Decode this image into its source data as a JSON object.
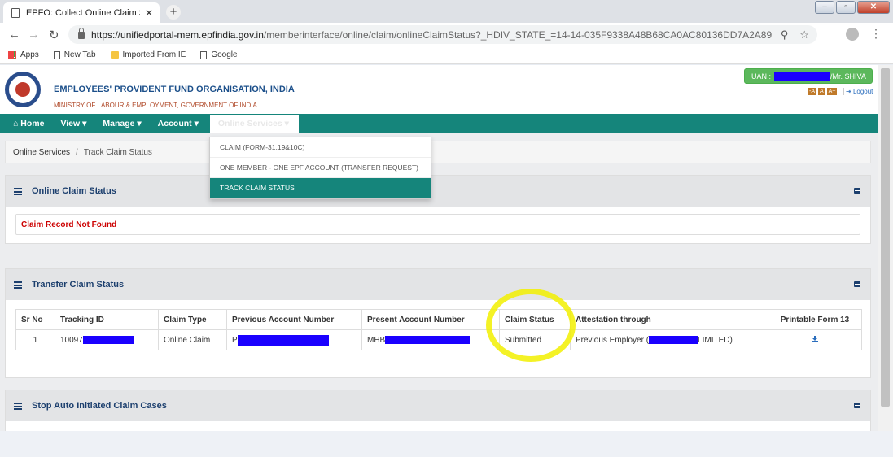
{
  "browser": {
    "tab_title": "EPFO: Collect Online Claim Status",
    "tab_close": "✕",
    "new_tab": "+",
    "url_host": "https://unifiedportal-mem.epfindia.gov.in",
    "url_path": "/memberinterface/online/claim/onlineClaimStatus?_HDIV_STATE_=14-14-035F9338A48B68CA0AC80136DD7A2A89",
    "bookmarks": [
      "Apps",
      "New Tab",
      "Imported From IE",
      "Google"
    ]
  },
  "header": {
    "org_name": "EMPLOYEES' PROVIDENT FUND ORGANISATION, INDIA",
    "ministry": "MINISTRY OF LABOUR & EMPLOYMENT, GOVERNMENT OF INDIA",
    "uan_label": "UAN :",
    "user_name": "/Mr. SHIVA",
    "font_small": "-A",
    "font_normal": "A",
    "font_large": "A+",
    "logout": "Logout"
  },
  "nav": {
    "home": "Home",
    "view": "View ▾",
    "manage": "Manage ▾",
    "account": "Account ▾",
    "online_services": "Online Services ▾"
  },
  "dropdown": {
    "items": [
      "CLAIM (FORM-31,19&10C)",
      "ONE MEMBER - ONE EPF ACCOUNT (TRANSFER REQUEST)",
      "TRACK CLAIM STATUS"
    ]
  },
  "breadcrumb": {
    "parent": "Online Services",
    "separator": "/",
    "current": "Track Claim Status"
  },
  "online_claim": {
    "title": "Online Claim Status",
    "message": "Claim Record Not Found"
  },
  "transfer_claim": {
    "title": "Transfer Claim Status",
    "columns": [
      "Sr No",
      "Tracking ID",
      "Claim Type",
      "Previous Account Number",
      "Present Account Number",
      "Claim Status",
      "Attestation through",
      "Printable Form 13"
    ],
    "row": {
      "sr_no": "1",
      "tracking_id": "10097",
      "claim_type": "Online Claim",
      "previous_account": "P",
      "present_account": "MHB",
      "claim_status": "Submitted",
      "attestation_prefix": "Previous Employer",
      "attestation_suffix": "LIMITED)"
    }
  },
  "auto_claim": {
    "title": "Stop Auto Initiated Claim Cases"
  },
  "colors": {
    "brand_teal": "#15857b",
    "redaction_blue": "#1a00ff",
    "highlight_yellow": "#f2f000",
    "error_red": "#cc0000"
  }
}
